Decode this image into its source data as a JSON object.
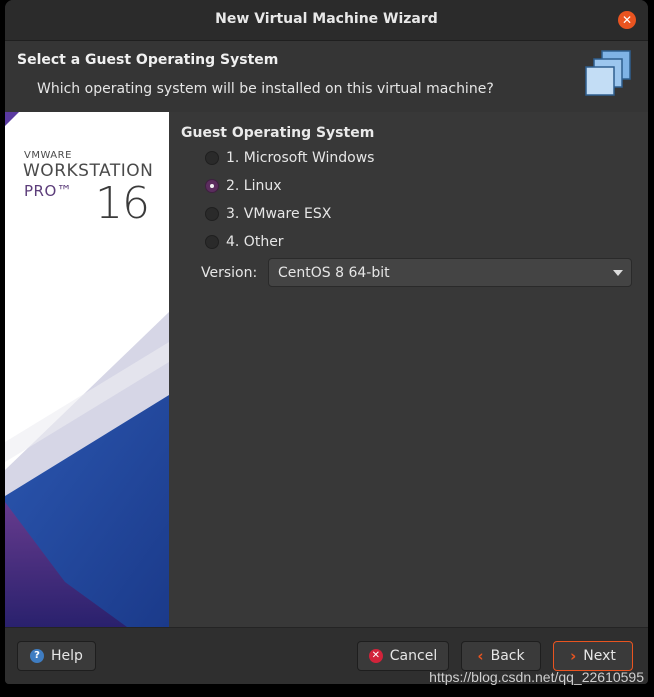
{
  "window": {
    "title": "New Virtual Machine Wizard"
  },
  "header": {
    "title": "Select a Guest Operating System",
    "subtitle": "Which operating system will be installed on this virtual machine?"
  },
  "banner": {
    "brand": "VMWARE",
    "product": "WORKSTATION",
    "edition": "PRO™",
    "version": "16"
  },
  "guest_os": {
    "label": "Guest Operating System",
    "options": [
      {
        "label": "1. Microsoft Windows",
        "selected": false
      },
      {
        "label": "2. Linux",
        "selected": true
      },
      {
        "label": "3. VMware ESX",
        "selected": false
      },
      {
        "label": "4. Other",
        "selected": false
      }
    ]
  },
  "version": {
    "label": "Version:",
    "value": "CentOS 8 64-bit"
  },
  "buttons": {
    "help": "Help",
    "cancel": "Cancel",
    "back": "Back",
    "next": "Next"
  },
  "icons": {
    "close": "close-icon",
    "help": "help-icon",
    "cancel": "cancel-icon",
    "back": "chevron-left-icon",
    "next": "chevron-right-icon"
  },
  "colors": {
    "accent": "#e95420",
    "radio_selected": "#5b2d5e"
  },
  "watermark": "https://blog.csdn.net/qq_22610595"
}
